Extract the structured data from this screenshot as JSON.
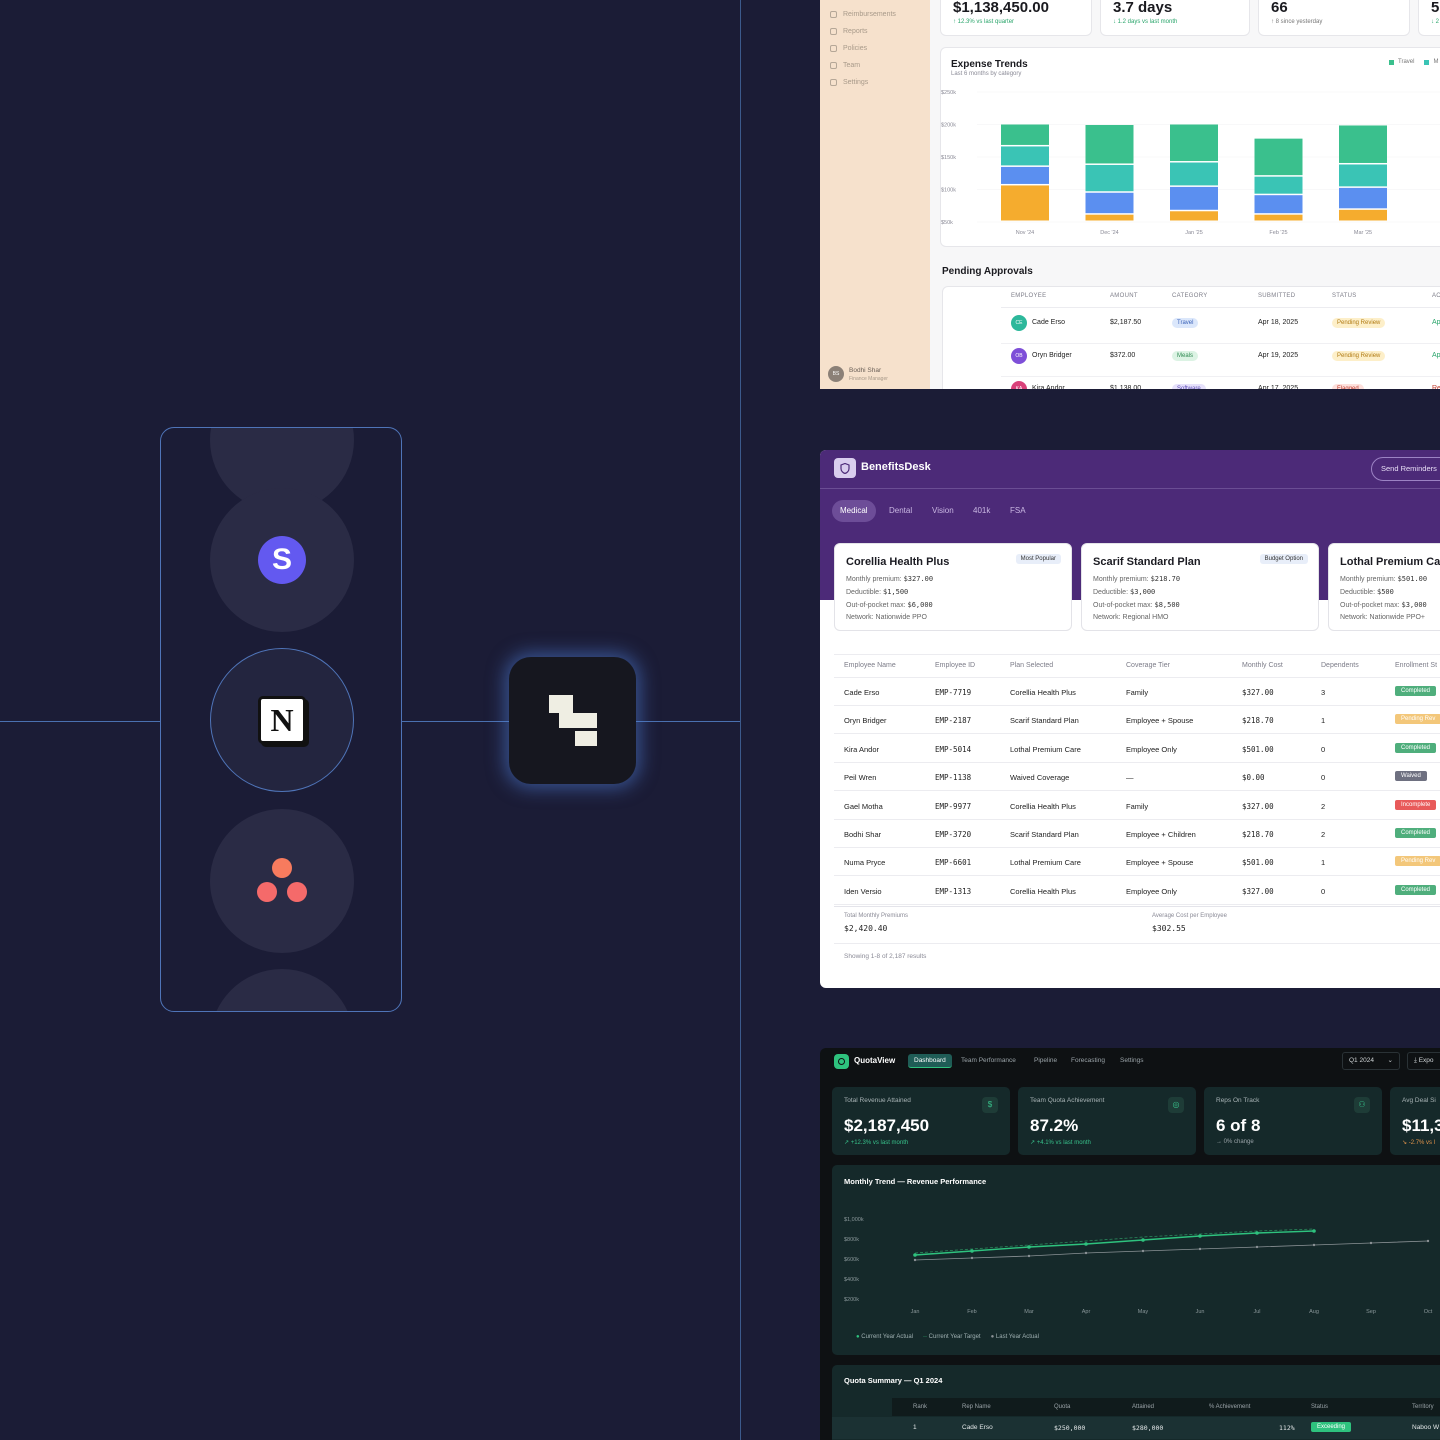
{
  "integrations": [
    "stripe-icon",
    "notion-icon",
    "asana-icon"
  ],
  "expense": {
    "nav": [
      "Reimbursements",
      "Reports",
      "Policies",
      "Team",
      "Settings"
    ],
    "user": {
      "initials": "BS",
      "name": "Bodhi Shar",
      "role": "Finance Manager"
    },
    "kpis": [
      {
        "value": "$1,138,450.00",
        "sub": "↑ 12.3% vs last quarter"
      },
      {
        "value": "3.7 days",
        "sub": "↓ 1.2 days vs last month"
      },
      {
        "value": "66",
        "sub": "↑ 8 since yesterday"
      },
      {
        "value": "5",
        "sub": "↓ 2"
      }
    ],
    "trends_title": "Expense Trends",
    "trends_sub": "Last 6 months by category",
    "legend": [
      "Travel",
      "M"
    ],
    "pending_title": "Pending Approvals",
    "columns": [
      "EMPLOYEE",
      "AMOUNT",
      "CATEGORY",
      "SUBMITTED",
      "STATUS",
      "AC"
    ],
    "rows": [
      {
        "initials": "CE",
        "name": "Cade Erso",
        "amount": "$2,187.50",
        "category": "Travel",
        "submitted": "Apr 18, 2025",
        "status": "Pending Review",
        "action": "Ap"
      },
      {
        "initials": "OB",
        "name": "Oryn Bridger",
        "amount": "$372.00",
        "category": "Meals",
        "submitted": "Apr 19, 2025",
        "status": "Pending Review",
        "action": "Ap"
      },
      {
        "initials": "KA",
        "name": "Kira Andor",
        "amount": "$1,138.00",
        "category": "Software",
        "submitted": "Apr 17, 2025",
        "status": "Flagged",
        "action": "Re"
      }
    ]
  },
  "chart_data": {
    "type": "bar",
    "stacked": true,
    "title": "Expense Trends",
    "categories": [
      "Nov '24",
      "Dec '24",
      "Jan '25",
      "Feb '25",
      "Mar '25"
    ],
    "ylim": [
      0,
      250000
    ],
    "yticks": [
      "$50k",
      "$100k",
      "$150k",
      "$200k",
      "$250k"
    ],
    "series": [
      {
        "name": "",
        "color": "#f5ac2e",
        "values": [
          75000,
          15000,
          22000,
          15000,
          25000
        ]
      },
      {
        "name": "",
        "color": "#5b8ff0",
        "values": [
          38000,
          45000,
          50000,
          40000,
          45000
        ]
      },
      {
        "name": "",
        "color": "#3ac4b5",
        "values": [
          42000,
          57000,
          50000,
          38000,
          48000
        ]
      },
      {
        "name": "Travel",
        "color": "#3ac08d",
        "values": [
          45000,
          82000,
          78000,
          78000,
          80000
        ]
      }
    ]
  },
  "benefits": {
    "app_name": "BenefitsDesk",
    "send_button": "Send Reminders",
    "tabs": [
      "Medical",
      "Dental",
      "Vision",
      "401k",
      "FSA"
    ],
    "plans": [
      {
        "name": "Corellia Health Plus",
        "tag": "Most Popular",
        "premium_label": "Monthly premium:",
        "premium": "$327.00",
        "deductible_label": "Deductible:",
        "deductible": "$1,500",
        "oop_label": "Out-of-pocket max:",
        "oop": "$6,000",
        "network": "Network: Nationwide PPO"
      },
      {
        "name": "Scarif Standard Plan",
        "tag": "Budget Option",
        "premium_label": "Monthly premium:",
        "premium": "$218.70",
        "deductible_label": "Deductible:",
        "deductible": "$3,000",
        "oop_label": "Out-of-pocket max:",
        "oop": "$8,500",
        "network": "Network: Regional HMO"
      },
      {
        "name": "Lothal Premium Ca",
        "tag": "",
        "premium_label": "Monthly premium:",
        "premium": "$501.00",
        "deductible_label": "Deductible:",
        "deductible": "$500",
        "oop_label": "Out-of-pocket max:",
        "oop": "$3,000",
        "network": "Network: Nationwide PPO+"
      }
    ],
    "columns": [
      "Employee Name",
      "Employee ID",
      "Plan Selected",
      "Coverage Tier",
      "Monthly Cost",
      "Dependents",
      "Enrollment St"
    ],
    "rows": [
      {
        "name": "Cade Erso",
        "id": "EMP-7719",
        "plan": "Corellia Health Plus",
        "tier": "Family",
        "cost": "$327.00",
        "deps": "3",
        "status": "Completed",
        "color": "#4fae7c"
      },
      {
        "name": "Oryn Bridger",
        "id": "EMP-2187",
        "plan": "Scarif Standard Plan",
        "tier": "Employee + Spouse",
        "cost": "$218.70",
        "deps": "1",
        "status": "Pending Rev",
        "color": "#f3c77a"
      },
      {
        "name": "Kira Andor",
        "id": "EMP-5014",
        "plan": "Lothal Premium Care",
        "tier": "Employee Only",
        "cost": "$501.00",
        "deps": "0",
        "status": "Completed",
        "color": "#4fae7c"
      },
      {
        "name": "Peil Wren",
        "id": "EMP-1138",
        "plan": "Waived Coverage",
        "tier": "—",
        "cost": "$0.00",
        "deps": "0",
        "status": "Waived",
        "color": "#6e7080"
      },
      {
        "name": "Gael Motha",
        "id": "EMP-9977",
        "plan": "Corellia Health Plus",
        "tier": "Family",
        "cost": "$327.00",
        "deps": "2",
        "status": "Incomplete",
        "color": "#e85a5a"
      },
      {
        "name": "Bodhi Shar",
        "id": "EMP-3720",
        "plan": "Scarif Standard Plan",
        "tier": "Employee + Children",
        "cost": "$218.70",
        "deps": "2",
        "status": "Completed",
        "color": "#4fae7c"
      },
      {
        "name": "Numa Pryce",
        "id": "EMP-6601",
        "plan": "Lothal Premium Care",
        "tier": "Employee + Spouse",
        "cost": "$501.00",
        "deps": "1",
        "status": "Pending Rev",
        "color": "#f3c77a"
      },
      {
        "name": "Iden Versio",
        "id": "EMP-1313",
        "plan": "Corellia Health Plus",
        "tier": "Employee Only",
        "cost": "$327.00",
        "deps": "0",
        "status": "Completed",
        "color": "#4fae7c"
      }
    ],
    "total_label": "Total Monthly Premiums",
    "total_value": "$2,420.40",
    "avg_label": "Average Cost per Employee",
    "avg_value": "$302.55",
    "showing": "Showing 1-8 of 2,187 results"
  },
  "quota": {
    "app_name": "QuotaView",
    "nav": [
      "Dashboard",
      "Team Performance",
      "Pipeline",
      "Forecasting",
      "Settings"
    ],
    "period": "Q1 2024",
    "export": "Expo",
    "kpis": [
      {
        "title": "Total Revenue Attained",
        "value": "$2,187,450",
        "sub": "↗ +12.3% vs last month",
        "icon": "$"
      },
      {
        "title": "Team Quota Achievement",
        "value": "87.2%",
        "sub": "↗ +4.1% vs last month",
        "icon": "◎"
      },
      {
        "title": "Reps On Track",
        "value": "6 of 8",
        "sub": "→ 0% change",
        "icon": "⚇"
      },
      {
        "title": "Avg Deal Si",
        "value": "$11,3",
        "sub": "↘ -2.7% vs l",
        "icon": ""
      }
    ],
    "trend_title": "Monthly Trend — Revenue Performance",
    "legend": [
      "Current Year Actual",
      "Current Year Target",
      "Last Year Actual"
    ],
    "summary_title": "Quota Summary — Q1 2024",
    "columns": [
      "Rank",
      "Rep Name",
      "Quota",
      "Attained",
      "% Achievement",
      "Status",
      "Territory"
    ],
    "rows": [
      {
        "rank": "1",
        "name": "Cade Erso",
        "quota": "$250,000",
        "attained": "$280,000",
        "pct": "112%",
        "status": "Exceeding",
        "territory": "Naboo W"
      }
    ]
  },
  "line_chart": {
    "type": "line",
    "title": "Monthly Trend — Revenue Performance",
    "x": [
      "Jan",
      "Feb",
      "Mar",
      "Apr",
      "May",
      "Jun",
      "Jul",
      "Aug",
      "Sep",
      "Oct"
    ],
    "yticks": [
      "$200k",
      "$400k",
      "$600k",
      "$800k",
      "$1,000k"
    ],
    "ylim": [
      100000,
      1100000
    ],
    "series": [
      {
        "name": "Current Year Actual",
        "color": "#2ec27e",
        "values": [
          640000,
          680000,
          720000,
          750000,
          790000,
          830000,
          860000,
          880000,
          null,
          null
        ]
      },
      {
        "name": "Current Year Target",
        "color": "#2a8a5c",
        "values": [
          660000,
          700000,
          740000,
          780000,
          820000,
          850000,
          880000,
          900000,
          null,
          null
        ]
      },
      {
        "name": "Last Year Actual",
        "color": "#8b9296",
        "values": [
          590000,
          610000,
          630000,
          660000,
          680000,
          700000,
          720000,
          740000,
          760000,
          780000
        ]
      }
    ]
  }
}
